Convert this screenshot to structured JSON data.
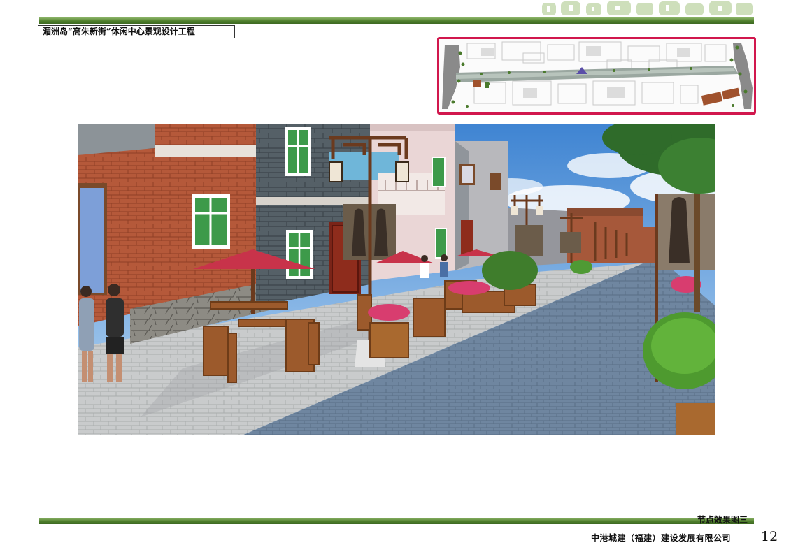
{
  "document": {
    "title": "湄洲岛“高朱新街”休闲中心景观设计工程",
    "caption": "节点效果图三",
    "company": "中港城建（福建）建设发展有限公司",
    "page_number": "12"
  },
  "colors": {
    "header_bar": "#4f7f2c",
    "keymap_border": "#d1174d",
    "brick": "#b5593a",
    "umbrella": "#c8334a",
    "sky": "#5f9edb",
    "paving": "#6f86a0"
  },
  "images": {
    "keymap": "site-plan-keymap",
    "rendering": "street-rendering-node-3"
  }
}
